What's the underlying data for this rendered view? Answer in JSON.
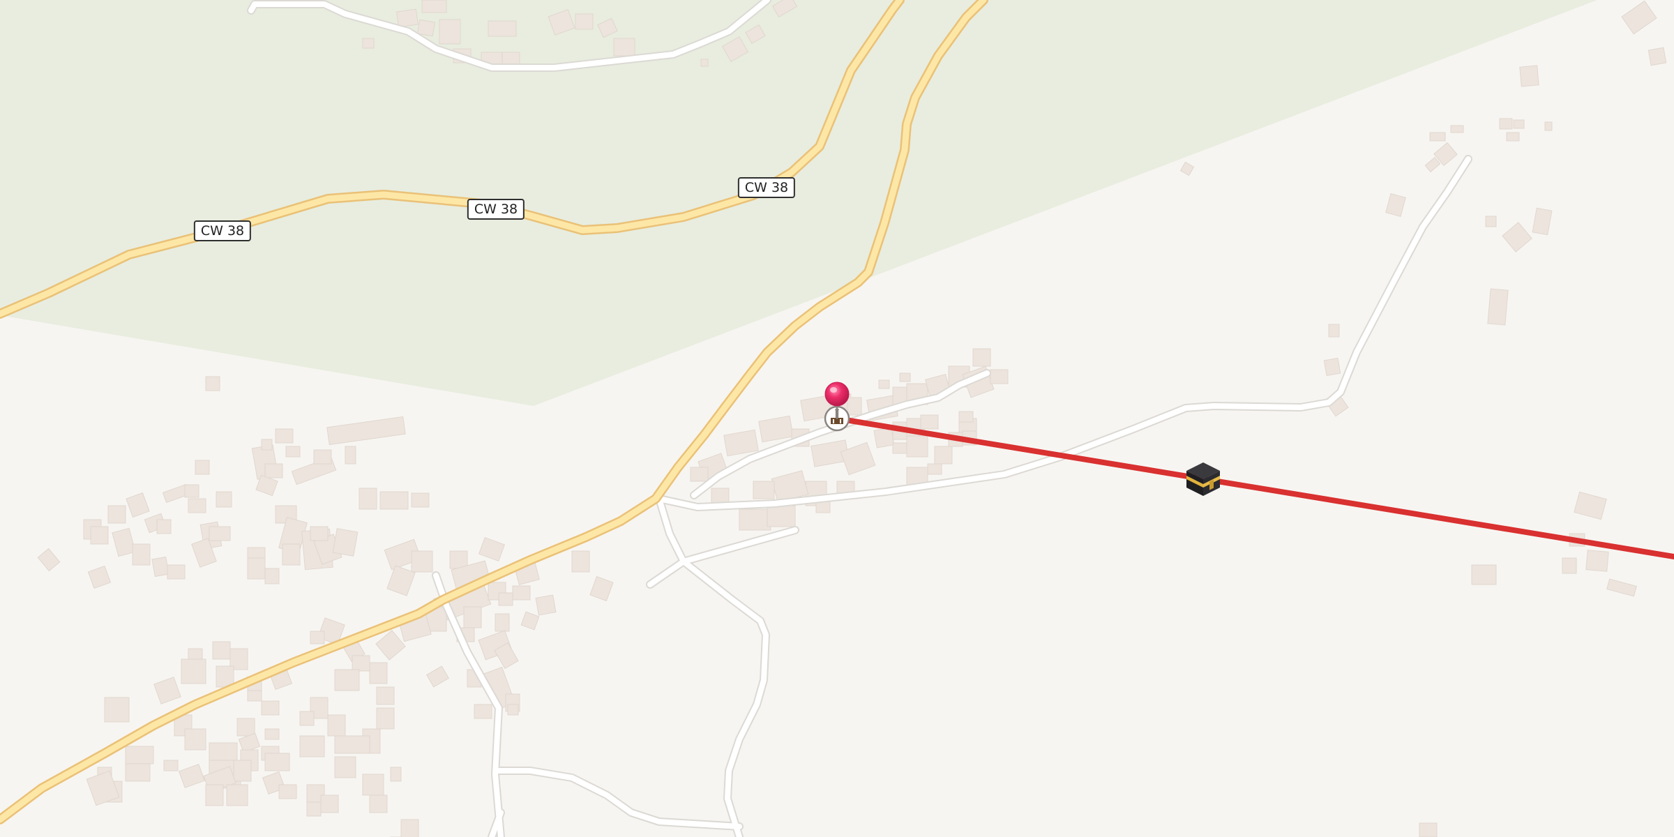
{
  "map": {
    "colors": {
      "background": "#f7f5f1",
      "forest": "#e8eddf",
      "primary_road_fill": "#fde7a6",
      "primary_road_casing": "#eac177",
      "minor_road_fill": "#ffffff",
      "minor_road_casing": "#dcd9d4",
      "building": "#ece4dd",
      "qibla_line": "#d93030",
      "pin": "#ec2d6a"
    },
    "road_labels": [
      "CW 38",
      "CW 38",
      "CW 38"
    ],
    "markers": {
      "location_pin": "location-pin-icon",
      "mosque": "mosque-icon",
      "kaaba": "kaaba-icon"
    },
    "qibla_line": "qibla-direction-line"
  }
}
